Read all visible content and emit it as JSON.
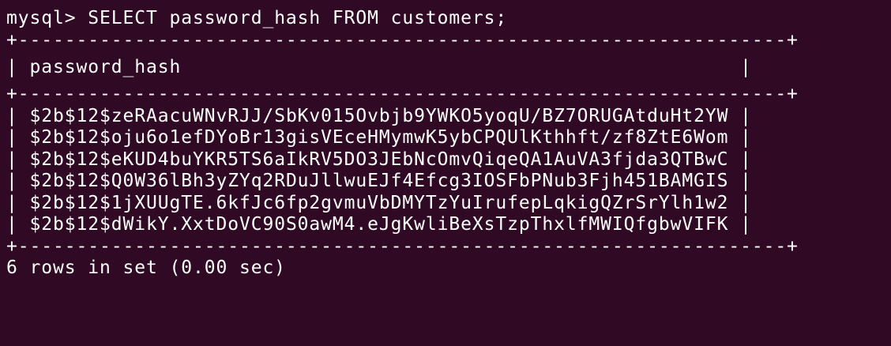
{
  "terminal": {
    "prompt": "mysql>",
    "command": "SELECT password_hash FROM customers;",
    "separator": "+------------------------------------------------------------------+",
    "column_header": "password_hash",
    "rows": [
      "$2b$12$zeRAacuWNvRJJ/SbKv015Ovbjb9YWKO5yoqU/BZ7ORUGAtduHt2YW",
      "$2b$12$oju6o1efDYoBr13gisVEceHMymwK5ybCPQUlKthhft/zf8ZtE6Wom",
      "$2b$12$eKUD4buYKR5TS6aIkRV5DO3JEbNcOmvQiqeQA1AuVA3fjda3QTBwC",
      "$2b$12$Q0W36lBh3yZYq2RDuJllwuEJf4Efcg3IOSFbPNub3Fjh451BAMGIS",
      "$2b$12$1jXUUgTE.6kfJc6fp2gvmuVbDMYTzYuIrufepLqkigQZrSrYlh1w2",
      "$2b$12$dWikY.XxtDoVC90S0awM4.eJgKwliBeXsTzpThxlfMWIQfgbwVIFK"
    ],
    "result_summary": "6 rows in set (0.00 sec)"
  },
  "colors": {
    "background": "#300a24",
    "text": "#ffffff"
  }
}
